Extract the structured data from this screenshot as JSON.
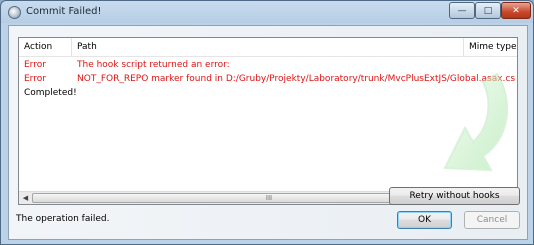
{
  "window": {
    "title": "Commit Failed!",
    "controls": {
      "minimize": "—",
      "maximize": "□",
      "close": "✕"
    }
  },
  "table": {
    "columns": {
      "action": "Action",
      "path": "Path",
      "mime": "Mime type"
    },
    "rows": [
      {
        "action": "Error",
        "path": "The hook script returned an error:",
        "kind": "error"
      },
      {
        "action": "Error",
        "path": "NOT_FOR_REPO marker found in D:/Gruby/Projekty/Laboratory/trunk/MvcPlusExtJS/Global.asax.cs",
        "kind": "error"
      },
      {
        "action": "Completed!",
        "path": "",
        "kind": "ok"
      }
    ],
    "error_color": "#e01414"
  },
  "scrollbar": {
    "left": "◀",
    "right": "▶",
    "grip": "III"
  },
  "buttons": {
    "retry": "Retry without hooks",
    "ok": "OK",
    "cancel": "Cancel"
  },
  "status_text": "The operation failed."
}
